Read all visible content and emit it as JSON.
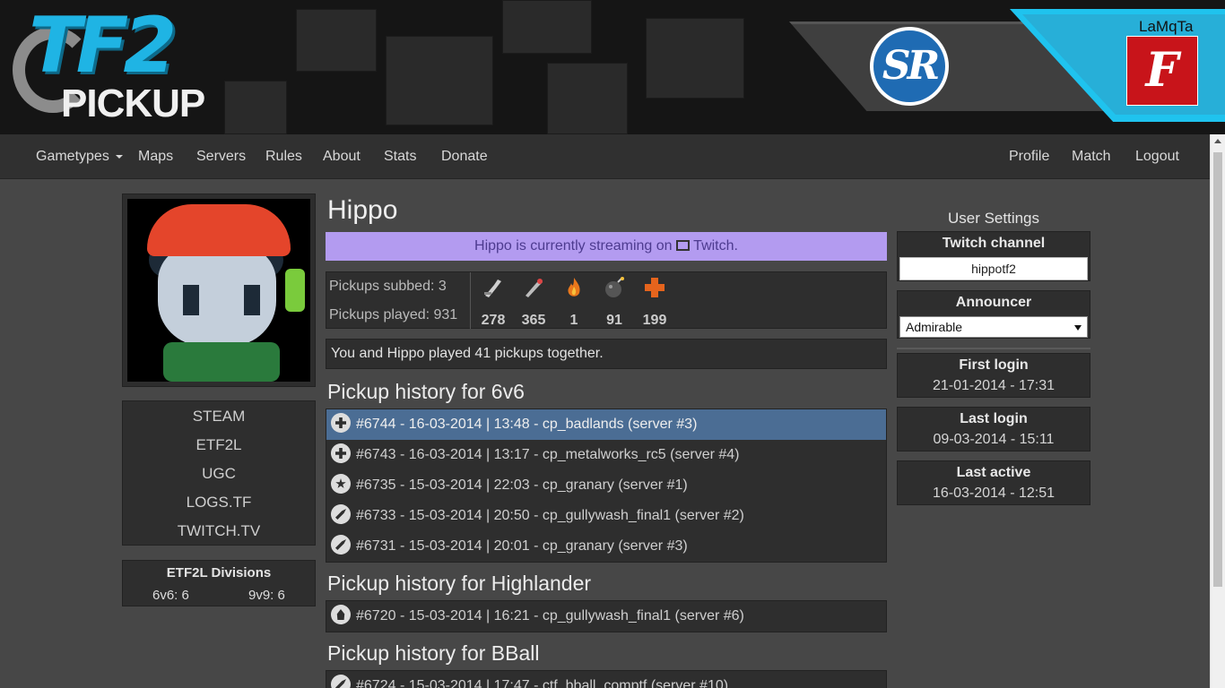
{
  "header": {
    "logo_top": "TF2",
    "logo_bottom": "PICKUP",
    "sponsor": "SR",
    "username": "LaMqTa",
    "avatar_letter": "F"
  },
  "nav": {
    "left": [
      "Gametypes",
      "Maps",
      "Servers",
      "Rules",
      "About",
      "Stats",
      "Donate"
    ],
    "right": [
      "Profile",
      "Match",
      "Logout"
    ]
  },
  "links": [
    "STEAM",
    "ETF2L",
    "UGC",
    "LOGS.TF",
    "TWITCH.TV"
  ],
  "divisions": {
    "title": "ETF2L Divisions",
    "six": "6v6: 6",
    "nine": "9v9: 6"
  },
  "player": {
    "name": "Hippo",
    "stream_before": "Hippo is currently streaming on",
    "stream_after": "Twitch.",
    "subbed": "Pickups subbed: 3",
    "played": "Pickups played: 931",
    "classes": [
      {
        "icon": "scout-icon",
        "count": "278"
      },
      {
        "icon": "soldier-icon",
        "count": "365"
      },
      {
        "icon": "pyro-icon",
        "count": "1"
      },
      {
        "icon": "demoman-icon",
        "count": "91"
      },
      {
        "icon": "medic-icon",
        "count": "199"
      }
    ],
    "together": "You and Hippo played 41 pickups together."
  },
  "history": {
    "sixes_title": "Pickup history for 6v6",
    "sixes": [
      {
        "icon": "medic",
        "text": "#6744 - 16-03-2014 | 13:48 - cp_badlands (server #3)"
      },
      {
        "icon": "medic",
        "text": "#6743 - 16-03-2014 | 13:17 - cp_metalworks_rc5 (server #4)"
      },
      {
        "icon": "star",
        "text": "#6735 - 15-03-2014 | 22:03 - cp_granary (server #1)"
      },
      {
        "icon": "wrench",
        "text": "#6733 - 15-03-2014 | 20:50 - cp_gullywash_final1 (server #2)"
      },
      {
        "icon": "wrench",
        "text": "#6731 - 15-03-2014 | 20:01 - cp_granary (server #3)"
      }
    ],
    "hl_title": "Pickup history for Highlander",
    "hl": [
      {
        "icon": "fire",
        "text": "#6720 - 15-03-2014 | 16:21 - cp_gullywash_final1 (server #6)"
      }
    ],
    "bball_title": "Pickup history for BBall",
    "bball": [
      {
        "icon": "wrench",
        "text": "#6724 - 15-03-2014 | 17:47 - ctf_bball_comptf (server #10)"
      }
    ]
  },
  "settings": {
    "title": "User Settings",
    "twitch_label": "Twitch channel",
    "twitch_value": "hippotf2",
    "announcer_label": "Announcer",
    "announcer_value": "Admirable",
    "first_login_label": "First login",
    "first_login": "21-01-2014 - 17:31",
    "last_login_label": "Last login",
    "last_login": "09-03-2014 - 15:11",
    "last_active_label": "Last active",
    "last_active": "16-03-2014 - 12:51"
  },
  "colors": {
    "accent": "#1fc3ee",
    "stream_banner": "#b39bf0",
    "active_row": "#4b6d94",
    "medic_icon": "#e5641d"
  }
}
